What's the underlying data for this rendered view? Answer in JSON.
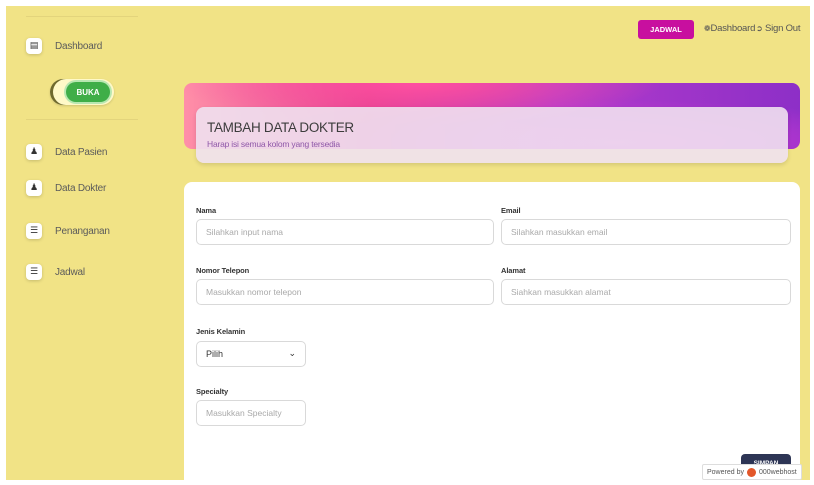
{
  "sidebar": {
    "items": [
      {
        "label": "Dashboard",
        "icon": "shop-icon"
      },
      {
        "label": "Data Pasien",
        "icon": "user-tie-icon"
      },
      {
        "label": "Data Dokter",
        "icon": "user-tie-icon"
      },
      {
        "label": "Penanganan",
        "icon": "list-icon"
      },
      {
        "label": "Jadwal",
        "icon": "list-icon"
      }
    ],
    "toggle_label": "BUKA"
  },
  "topbar": {
    "jadwal_button": "JADWAL",
    "dashboard_link": "Dashboard",
    "signout_link": "Sign Out"
  },
  "banner": {
    "title": "TAMBAH DATA DOKTER",
    "subtitle": "Harap isi semua kolom yang tersedia"
  },
  "form": {
    "nama": {
      "label": "Nama",
      "placeholder": "Silahkan input nama"
    },
    "email": {
      "label": "Email",
      "placeholder": "Silahkan masukkan email"
    },
    "telepon": {
      "label": "Nomor Telepon",
      "placeholder": "Masukkan nomor telepon"
    },
    "alamat": {
      "label": "Alamat",
      "placeholder": "Siahkan masukkan alamat"
    },
    "jenis_kelamin": {
      "label": "Jenis Kelamin",
      "selected": "Pilih"
    },
    "specialty": {
      "label": "Specialty",
      "placeholder": "Masukkan Specialty"
    },
    "submit_label": "SIMPAN"
  },
  "powered_by": {
    "prefix": "Powered by",
    "brand": "000webhost"
  },
  "colors": {
    "background": "#f1e386",
    "accent_magenta": "#c80f9f",
    "toggle_green": "#3fae48",
    "submit_dark": "#2d3555"
  }
}
